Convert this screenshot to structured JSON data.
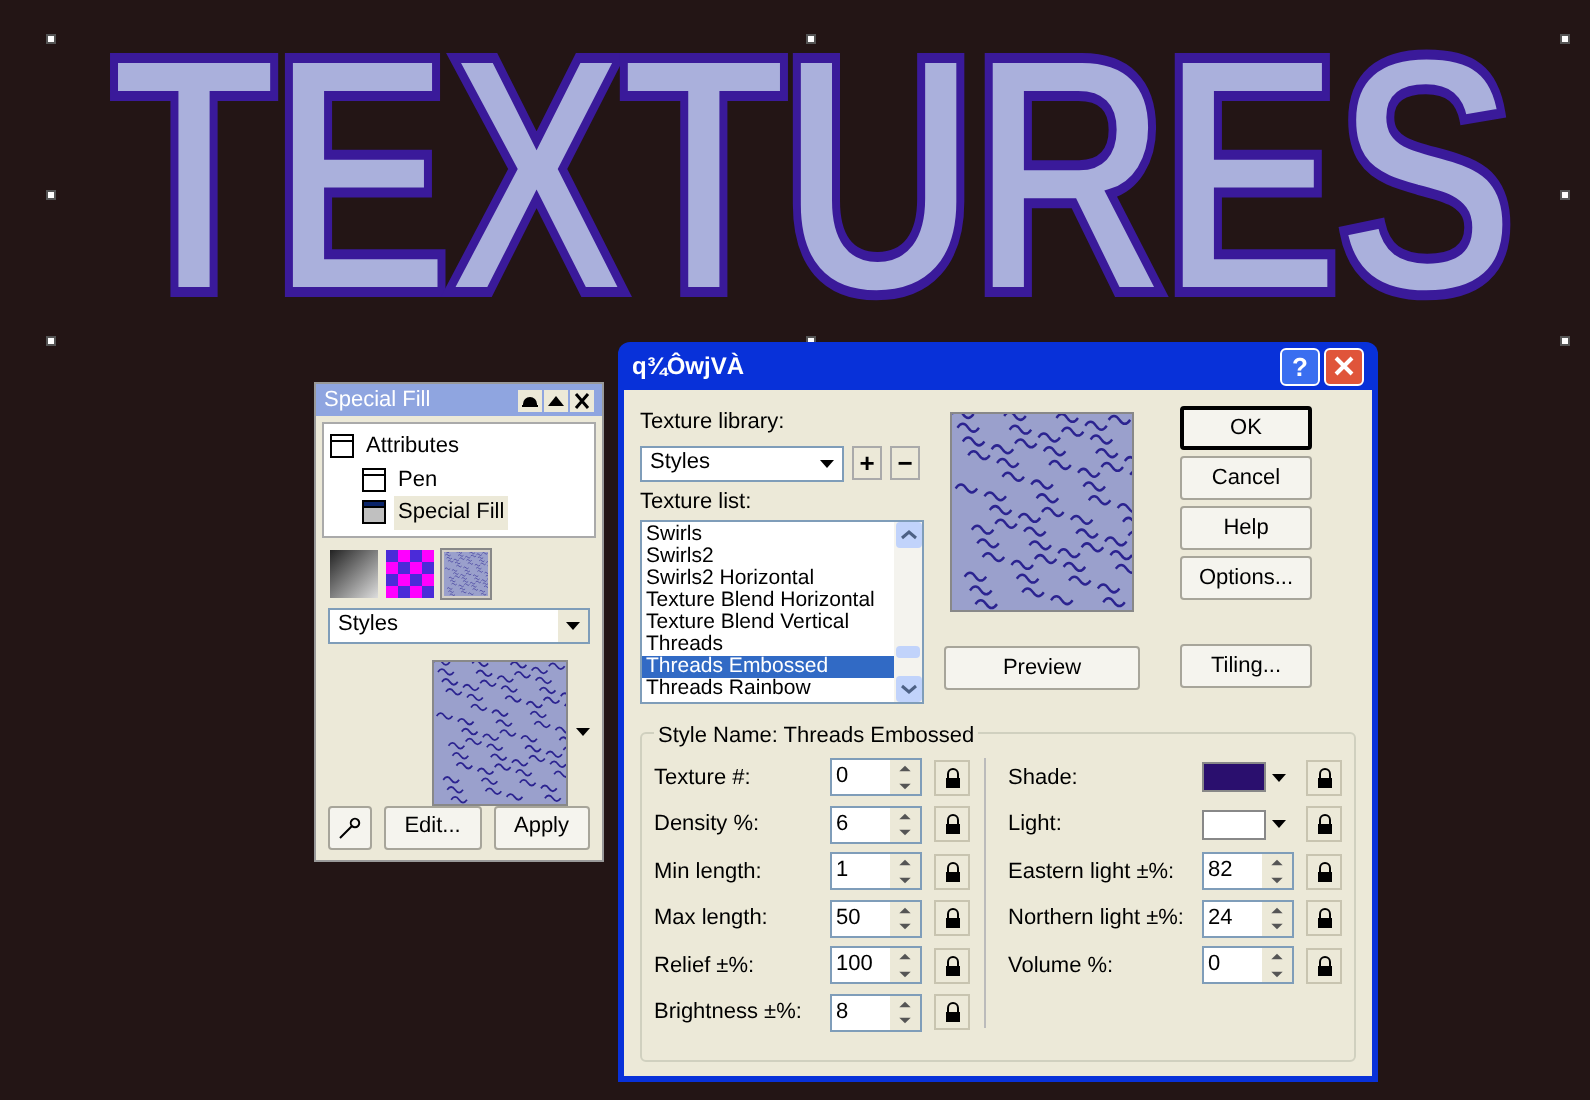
{
  "canvas": {
    "artwork_text": "TEXTURES"
  },
  "special_fill_panel": {
    "title": "Special Fill",
    "tree": [
      {
        "label": "Attributes",
        "selected": false,
        "children": [
          {
            "label": "Pen",
            "selected": false
          },
          {
            "label": "Special Fill",
            "selected": true
          }
        ]
      }
    ],
    "fill_types": [
      {
        "kind": "gradient",
        "selected": false
      },
      {
        "kind": "pattern",
        "selected": false
      },
      {
        "kind": "texture",
        "selected": true
      }
    ],
    "library": "Styles",
    "buttons": [
      "Edit...",
      "Apply"
    ]
  },
  "dialog": {
    "title": "q¾ÔwjVÀ",
    "help_button": "?",
    "texture_library_label": "Texture library:",
    "texture_library": "Styles",
    "add_button": "+",
    "remove_button": "−",
    "texture_list_label": "Texture list:",
    "texture_list": [
      {
        "label": "Swirls",
        "selected": false
      },
      {
        "label": "Swirls2",
        "selected": false
      },
      {
        "label": "Swirls2 Horizontal",
        "selected": false
      },
      {
        "label": "Texture Blend Horizontal",
        "selected": false
      },
      {
        "label": "Texture Blend Vertical",
        "selected": false
      },
      {
        "label": "Threads",
        "selected": false
      },
      {
        "label": "Threads Embossed",
        "selected": true
      },
      {
        "label": "Threads Rainbow",
        "selected": false
      }
    ],
    "preview_button": "Preview",
    "side_buttons": [
      {
        "label": "OK",
        "default": true
      },
      {
        "label": "Cancel",
        "default": false
      },
      {
        "label": "Help",
        "default": false
      },
      {
        "label": "Options...",
        "default": false
      }
    ],
    "tiling_button": "Tiling...",
    "style_group_title": "Style Name: Threads Embossed",
    "left_params": [
      {
        "label": "Texture #:",
        "value": "0"
      },
      {
        "label": "Density %:",
        "value": "6"
      },
      {
        "label": "Min length:",
        "value": "1"
      },
      {
        "label": "Max length:",
        "value": "50"
      },
      {
        "label": "Relief ±%:",
        "value": "100"
      },
      {
        "label": "Brightness ±%:",
        "value": "8"
      }
    ],
    "right_params": [
      {
        "kind": "color",
        "label": "Shade:",
        "color": "#2a0f6e"
      },
      {
        "kind": "color",
        "label": "Light:",
        "color": "#ffffff"
      },
      {
        "kind": "number",
        "label": "Eastern light ±%:",
        "value": "82"
      },
      {
        "kind": "number",
        "label": "Northern light ±%:",
        "value": "24"
      },
      {
        "kind": "number",
        "label": "Volume %:",
        "value": "0"
      }
    ]
  }
}
